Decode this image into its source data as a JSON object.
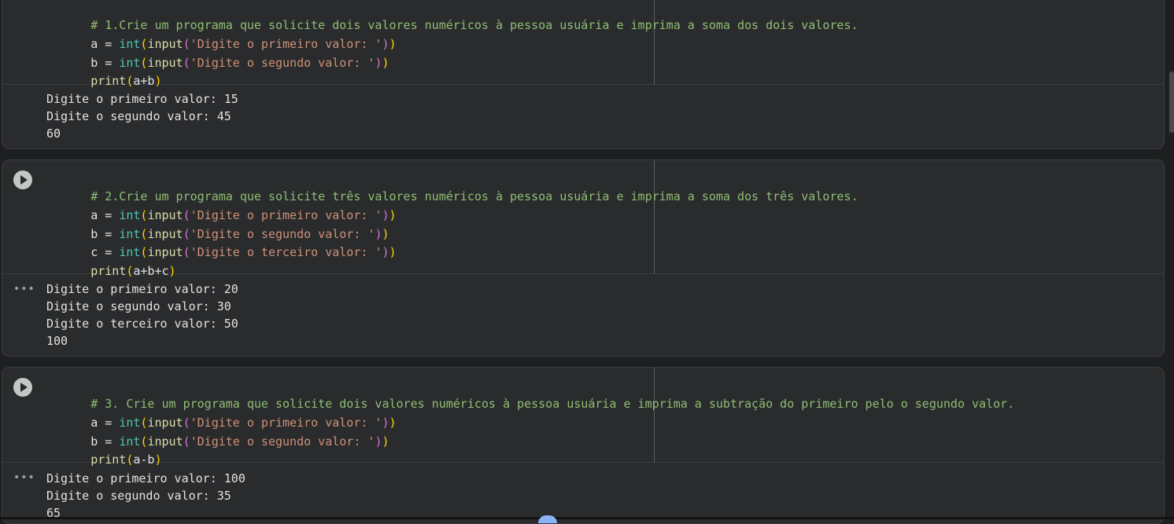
{
  "cells": [
    {
      "code": {
        "comment": "# 1.Crie um programa que solicite dois valores numéricos à pessoa usuária e imprima a soma dos dois valores.",
        "lines": [
          {
            "var": "a = ",
            "int_kw": "int",
            "input_kw": "input",
            "str": "'Digite o primeiro valor: '"
          },
          {
            "var": "b = ",
            "int_kw": "int",
            "input_kw": "input",
            "str": "'Digite o segundo valor: '"
          }
        ],
        "print": {
          "kw": "print",
          "args": "a+b"
        }
      },
      "output": [
        "Digite o primeiro valor: 15",
        "Digite o segundo valor: 45",
        "60"
      ]
    },
    {
      "code": {
        "comment": "# 2.Crie um programa que solicite três valores numéricos à pessoa usuária e imprima a soma dos três valores.",
        "lines": [
          {
            "var": "a = ",
            "int_kw": "int",
            "input_kw": "input",
            "str": "'Digite o primeiro valor: '"
          },
          {
            "var": "b = ",
            "int_kw": "int",
            "input_kw": "input",
            "str": "'Digite o segundo valor: '"
          },
          {
            "var": "c = ",
            "int_kw": "int",
            "input_kw": "input",
            "str": "'Digite o terceiro valor: '"
          }
        ],
        "print": {
          "kw": "print",
          "args": "a+b+c"
        }
      },
      "output": [
        "Digite o primeiro valor: 20",
        "Digite o segundo valor: 30",
        "Digite o terceiro valor: 50",
        "100"
      ]
    },
    {
      "code": {
        "comment": "# 3. Crie um programa que solicite dois valores numéricos à pessoa usuária e imprima a subtração do primeiro pelo o segundo valor.",
        "lines": [
          {
            "var": "a = ",
            "int_kw": "int",
            "input_kw": "input",
            "str": "'Digite o primeiro valor: '"
          },
          {
            "var": "b = ",
            "int_kw": "int",
            "input_kw": "input",
            "str": "'Digite o segundo valor: '"
          }
        ],
        "print": {
          "kw": "print",
          "args": "a-b"
        }
      },
      "output": [
        "Digite o primeiro valor: 100",
        "Digite o segundo valor: 35",
        "65"
      ]
    }
  ],
  "icons": {
    "run": "play-circle-icon",
    "more": "more-horiz-icon"
  },
  "colors": {
    "background": "#1e1f20",
    "cell": "#2a2b2d",
    "comment": "#8fbf73",
    "builtin": "#4ec9b0",
    "function": "#dcdcaa",
    "string": "#ce9178",
    "paren_outer": "#ffd700",
    "paren_inner": "#da70d6",
    "accent": "#8ab4f8"
  }
}
